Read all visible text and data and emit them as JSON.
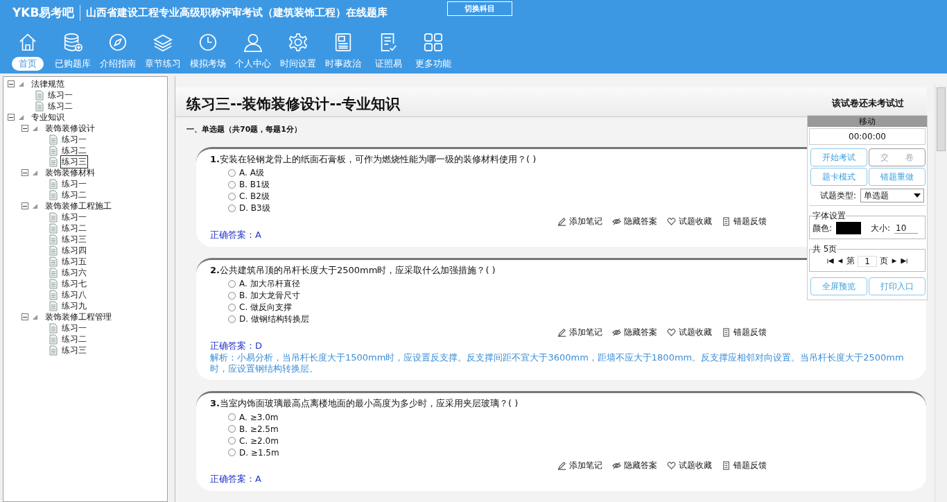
{
  "header": {
    "logo": "YKB易考吧",
    "title": "山西省建设工程专业高级职称评审考试（建筑装饰工程）在线题库",
    "switch_button": "切换科目"
  },
  "nav": [
    {
      "label": "首页",
      "kind": "home",
      "selected": true
    },
    {
      "label": "已购题库",
      "kind": "database",
      "selected": false
    },
    {
      "label": "介绍指南",
      "kind": "compass",
      "selected": false
    },
    {
      "label": "章节练习",
      "kind": "layers",
      "selected": false
    },
    {
      "label": "模拟考场",
      "kind": "clock",
      "selected": false
    },
    {
      "label": "个人中心",
      "kind": "user",
      "selected": false
    },
    {
      "label": "时间设置",
      "kind": "gear",
      "selected": false
    },
    {
      "label": "时事政治",
      "kind": "news",
      "selected": false
    },
    {
      "label": "证照易",
      "kind": "checklist",
      "selected": false
    },
    {
      "label": "更多功能",
      "kind": "grid",
      "selected": false
    }
  ],
  "tree": [
    {
      "label": "法律规范",
      "expanded": true,
      "children": [
        {
          "label": "练习一",
          "selected": false
        },
        {
          "label": "练习二",
          "selected": false
        }
      ]
    },
    {
      "label": "专业知识",
      "expanded": true,
      "children": [
        {
          "label": "装饰装修设计",
          "expanded": true,
          "children": [
            {
              "label": "练习一",
              "selected": false
            },
            {
              "label": "练习二",
              "selected": false
            },
            {
              "label": "练习三",
              "selected": true
            }
          ]
        },
        {
          "label": "装饰装修材料",
          "expanded": true,
          "children": [
            {
              "label": "练习一",
              "selected": false
            },
            {
              "label": "练习二",
              "selected": false
            }
          ]
        },
        {
          "label": "装饰装修工程施工",
          "expanded": true,
          "children": [
            {
              "label": "练习一",
              "selected": false
            },
            {
              "label": "练习二",
              "selected": false
            },
            {
              "label": "练习三",
              "selected": false
            },
            {
              "label": "练习四",
              "selected": false
            },
            {
              "label": "练习五",
              "selected": false
            },
            {
              "label": "练习六",
              "selected": false
            },
            {
              "label": "练习七",
              "selected": false
            },
            {
              "label": "练习八",
              "selected": false
            },
            {
              "label": "练习九",
              "selected": false
            }
          ]
        },
        {
          "label": "装饰装修工程管理",
          "expanded": true,
          "children": [
            {
              "label": "练习一",
              "selected": false
            },
            {
              "label": "练习二",
              "selected": false
            },
            {
              "label": "练习三",
              "selected": false
            }
          ]
        }
      ]
    }
  ],
  "paper": {
    "title": "练习三--装饰装修设计--专业知识",
    "status": "该试卷还未考试过",
    "section": "一、单选题（共70题，每题1分）"
  },
  "questions": [
    {
      "number": "1.",
      "text": "安装在轻钢龙骨上的纸面石膏板，可作为燃烧性能为哪一级的装修材料使用？( )",
      "options": [
        {
          "letter": "A.",
          "text": "A级",
          "selected": false
        },
        {
          "letter": "B.",
          "text": "B1级",
          "selected": false
        },
        {
          "letter": "C.",
          "text": "B2级",
          "selected": false
        },
        {
          "letter": "D.",
          "text": "B3级",
          "selected": false
        }
      ],
      "actions": [
        "添加笔记",
        "隐藏答案",
        "试题收藏",
        "错题反馈"
      ],
      "answer_label": "正确答案：",
      "answer": "A"
    },
    {
      "number": "2.",
      "text": "公共建筑吊顶的吊杆长度大于2500mm时，应采取什么加强措施？( )",
      "options": [
        {
          "letter": "A.",
          "text": "加大吊杆直径",
          "selected": false
        },
        {
          "letter": "B.",
          "text": "加大龙骨尺寸",
          "selected": false
        },
        {
          "letter": "C.",
          "text": "做反向支撑",
          "selected": false
        },
        {
          "letter": "D.",
          "text": "做钢结构转换层",
          "selected": false
        }
      ],
      "actions": [
        "添加笔记",
        "隐藏答案",
        "试题收藏",
        "错题反馈"
      ],
      "answer_label": "正确答案：",
      "answer": "D",
      "explanation": "解析：小易分析，当吊杆长度大于1500mm时，应设置反支撑。反支撑间距不宜大于3600mm，距墙不应大于1800mm。反支撑应相邻对向设置。当吊杆长度大于2500mm时，应设置钢结构转换层。"
    },
    {
      "number": "3.",
      "text": "当室内饰面玻璃最高点离楼地面的最小高度为多少时，应采用夹层玻璃？( )",
      "options": [
        {
          "letter": "A.",
          "text": "≥3.0m",
          "selected": false
        },
        {
          "letter": "B.",
          "text": "≥2.5m",
          "selected": false
        },
        {
          "letter": "C.",
          "text": "≥2.0m",
          "selected": false
        },
        {
          "letter": "D.",
          "text": "≥1.5m",
          "selected": false
        }
      ],
      "actions": [
        "添加笔记",
        "隐藏答案",
        "试题收藏",
        "错题反馈"
      ],
      "answer_label": "正确答案：",
      "answer": "A"
    }
  ],
  "panel": {
    "move": "移动",
    "timer": "00:00:00",
    "buttons": [
      {
        "label": "开始考试",
        "disabled": false
      },
      {
        "label": "交　　卷",
        "disabled": true
      },
      {
        "label": "题卡模式",
        "disabled": false
      },
      {
        "label": "错题重做",
        "disabled": false
      }
    ],
    "type_label": "试题类型:",
    "type_value": "单选题",
    "font_legend": "字体设置",
    "color_label": "颜色:",
    "color": "#000000",
    "size_label": "大小:",
    "size": "10",
    "pager_legend": "共 5页",
    "page_prefix": "第",
    "page": "1",
    "page_suffix": "页",
    "bottom_buttons": [
      "全屏预览",
      "打印入口"
    ]
  }
}
